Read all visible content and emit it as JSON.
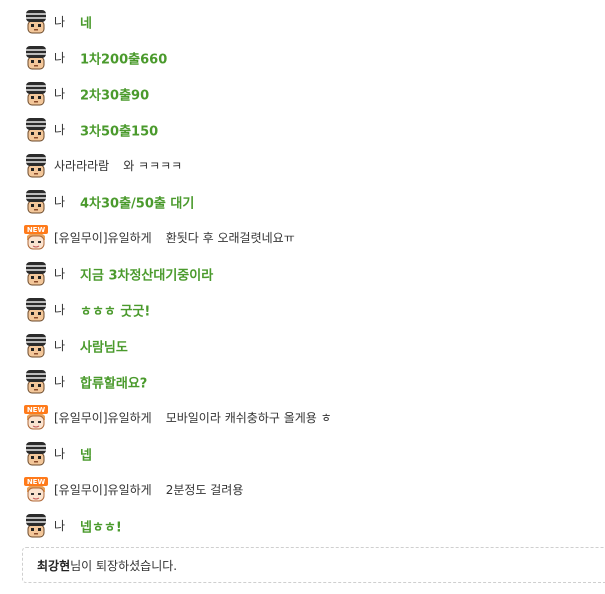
{
  "chat": {
    "messages": [
      {
        "sender": "나",
        "mine": true,
        "avatar": "helmet",
        "text": "네"
      },
      {
        "sender": "나",
        "mine": true,
        "avatar": "helmet",
        "text": "1차200출660"
      },
      {
        "sender": "나",
        "mine": true,
        "avatar": "helmet",
        "text": "2차30출90"
      },
      {
        "sender": "나",
        "mine": true,
        "avatar": "helmet",
        "text": "3차50출150"
      },
      {
        "sender": "사라라라람",
        "mine": false,
        "avatar": "helmet",
        "text": "와 ㅋㅋㅋㅋ"
      },
      {
        "sender": "나",
        "mine": true,
        "avatar": "helmet",
        "text": "4차30출/50출 대기"
      },
      {
        "sender": "[유일무이]유일하게",
        "mine": false,
        "avatar": "new",
        "text": "환됫다 후 오래걸렷네요ㅠ"
      },
      {
        "sender": "나",
        "mine": true,
        "avatar": "helmet",
        "text": "지금 3차정산대기중이라"
      },
      {
        "sender": "나",
        "mine": true,
        "avatar": "helmet",
        "text": "ㅎㅎㅎ 굿굿!"
      },
      {
        "sender": "나",
        "mine": true,
        "avatar": "helmet",
        "text": "사람님도"
      },
      {
        "sender": "나",
        "mine": true,
        "avatar": "helmet",
        "text": "합류할래요?"
      },
      {
        "sender": "[유일무이]유일하게",
        "mine": false,
        "avatar": "new",
        "text": "모바일이라 캐쉬충하구 올게용 ㅎ"
      },
      {
        "sender": "나",
        "mine": true,
        "avatar": "helmet",
        "text": "넵"
      },
      {
        "sender": "[유일무이]유일하게",
        "mine": false,
        "avatar": "new",
        "text": "2분정도 걸려용"
      },
      {
        "sender": "나",
        "mine": true,
        "avatar": "helmet",
        "text": "넵ㅎㅎ!"
      }
    ]
  },
  "notice": {
    "user": "최강현",
    "text": "님이 퇴장하셨습니다."
  },
  "colors": {
    "my_message": "#4a9a2c",
    "text": "#333333",
    "notice_border": "#cfcfcf"
  },
  "icons": {
    "helmet": "helmet-avatar-icon",
    "new": "new-badge-avatar-icon"
  }
}
